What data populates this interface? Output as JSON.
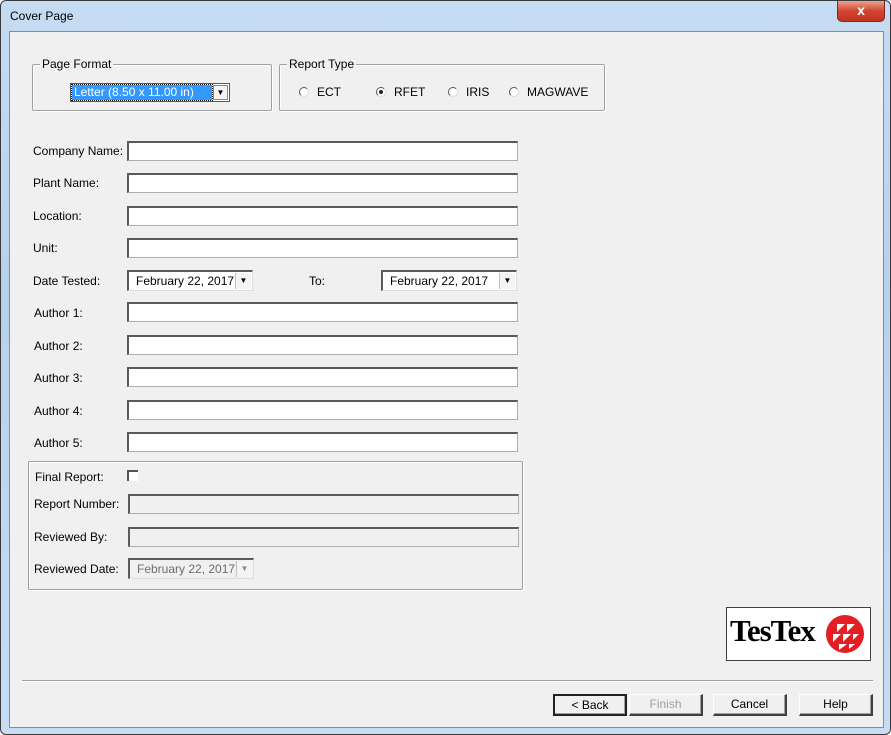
{
  "window": {
    "title": "Cover Page",
    "close_label": "x"
  },
  "page_format": {
    "legend": "Page Format",
    "selected": "Letter (8.50 x 11.00 in)",
    "dropdown_icon": "chevron-down-icon"
  },
  "report_type": {
    "legend": "Report Type",
    "options": [
      {
        "label": "ECT",
        "checked": false
      },
      {
        "label": "RFET",
        "checked": true
      },
      {
        "label": "IRIS",
        "checked": false
      },
      {
        "label": "MAGWAVE",
        "checked": false
      }
    ]
  },
  "fields": {
    "company_name": {
      "label": "Company Name:",
      "value": ""
    },
    "plant_name": {
      "label": "Plant Name:",
      "value": ""
    },
    "location": {
      "label": "Location:",
      "value": ""
    },
    "unit": {
      "label": "Unit:",
      "value": ""
    },
    "date_tested": {
      "label": "Date Tested:",
      "value": "February  22, 2017"
    },
    "to": {
      "label": "To:",
      "value": "February  22, 2017"
    },
    "author1": {
      "label": "Author 1:",
      "value": ""
    },
    "author2": {
      "label": "Author 2:",
      "value": ""
    },
    "author3": {
      "label": "Author 3:",
      "value": ""
    },
    "author4": {
      "label": "Author 4:",
      "value": ""
    },
    "author5": {
      "label": "Author 5:",
      "value": ""
    }
  },
  "final_section": {
    "final_report": {
      "label": "Final Report:",
      "checked": false
    },
    "report_number": {
      "label": "Report Number:",
      "value": ""
    },
    "reviewed_by": {
      "label": "Reviewed By:",
      "value": ""
    },
    "reviewed_date": {
      "label": "Reviewed Date:",
      "value": "February  22, 2017"
    }
  },
  "logo": {
    "text": "TesTex",
    "colors": {
      "circle": "#e31e24",
      "text": "#000000"
    }
  },
  "buttons": {
    "back": "< Back",
    "finish": "Finish",
    "cancel": "Cancel",
    "help": "Help"
  },
  "colors": {
    "selection": "#3399ff",
    "close": "#c8412b",
    "frame": "#b9d3ef"
  }
}
